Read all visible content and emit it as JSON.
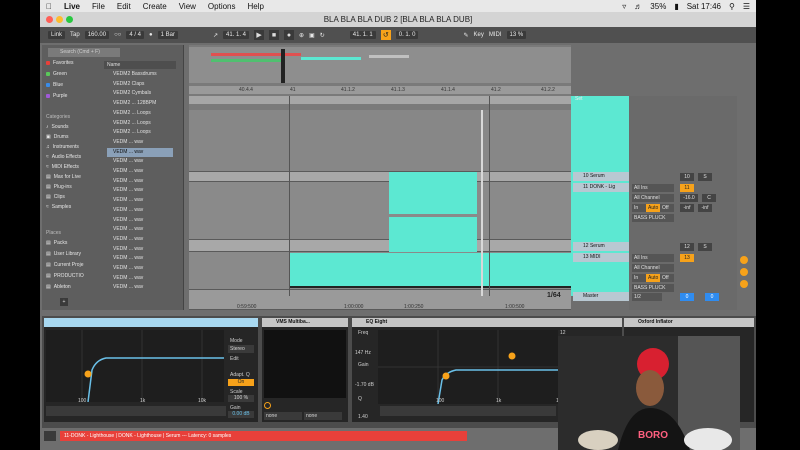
{
  "menubar": {
    "app": "Live",
    "items": [
      "File",
      "Edit",
      "Create",
      "View",
      "Options",
      "Help"
    ],
    "battery": "35%",
    "clock": "Sat 17:46"
  },
  "window": {
    "title": "BLA BLA BLA DUB 2  [BLA BLA BLA DUB]"
  },
  "transport": {
    "link": "Link",
    "tap": "Tap",
    "tempo": "160.00",
    "meter": "4 / 4",
    "quantize": "1 Bar",
    "position": "41.  1.  4",
    "loop_start": "41.  1.  1",
    "loop_length": "0.  1.  0",
    "key": "Key",
    "midi": "MIDI",
    "cpu": "13 %",
    "midi_track_num": "0"
  },
  "browser": {
    "search_placeholder": "Search (Cmd + F)",
    "collections": [
      {
        "label": "Favorites",
        "color": "#e8403a"
      },
      {
        "label": "Green",
        "color": "#5ac85a"
      },
      {
        "label": "Blue",
        "color": "#3a8ce8"
      },
      {
        "label": "Purple",
        "color": "#a05ad8"
      }
    ],
    "categories_title": "Categories",
    "categories": [
      "Sounds",
      "Drums",
      "Instruments",
      "Audio Effects",
      "MIDI Effects",
      "Max for Live",
      "Plug-ins",
      "Clips",
      "Samples"
    ],
    "places_title": "Places",
    "places": [
      "Packs",
      "User Library",
      "Current Proje",
      "PRODUCTIO",
      "Ableton"
    ],
    "file_header": "Name",
    "files": [
      "VEDM2 Bassdrums",
      "VEDM2 Claps",
      "VEDM2 Cymbals",
      "VEDM2 ... 128BPM",
      "VEDM2 ... Loops",
      "VEDM2 ... Loops",
      "VEDM2 ... Loops",
      "VEDM ... wav",
      "VEDM ... wav",
      "VEDM ... wav",
      "VEDM ... wav",
      "VEDM ... wav",
      "VEDM ... wav",
      "VEDM ... wav",
      "VEDM ... wav",
      "VEDM ... wav",
      "VEDM ... wav",
      "VEDM ... wav",
      "VEDM ... wav",
      "VEDM ... wav",
      "VEDM ... wav",
      "VEDM ... wav",
      "VEDM ... wav"
    ]
  },
  "arrangement": {
    "ruler_labels": [
      "40.4.4",
      "41",
      "41.1.2",
      "41.1.3",
      "41.1.4",
      "41.2",
      "41.2.2"
    ],
    "time_labels": [
      "0:59:500",
      "1:00:000",
      "1:00:250",
      "1:00:500"
    ],
    "zoom_label": "1/64"
  },
  "tracks": [
    {
      "name": "10 Serum",
      "num": "10",
      "arm": "S"
    },
    {
      "name": "11 DONK - Lig",
      "num": "11",
      "input": "All Ins",
      "channel": "All Channel",
      "monitor": [
        "In",
        "Auto",
        "Off"
      ],
      "pan": "C",
      "volume": "-16.0",
      "sends": [
        "-inf",
        "-inf"
      ],
      "instrument": "BASS PLUCK"
    },
    {
      "name": "12 Serum",
      "num": "12",
      "arm": "S"
    },
    {
      "name": "13 MIDI",
      "num": "13",
      "input": "All Ins",
      "channel": "All Channel",
      "monitor": [
        "In",
        "Auto",
        "Off"
      ],
      "instrument": "BASS PLUCK"
    },
    {
      "name": "Master",
      "num": "0",
      "cue": "1/2"
    }
  ],
  "devices": {
    "eq1": {
      "mode_label": "Mode",
      "mode": "Stereo",
      "edit_label": "Edit",
      "adapt_q_label": "Adapt. Q",
      "adapt_q": "On",
      "scale_label": "Scale",
      "scale": "100 %",
      "gain_label": "Gain",
      "gain": "0.00 dB",
      "freq_labels": [
        "100",
        "1k",
        "10k"
      ]
    },
    "vms": {
      "title": "VMS Multiba...",
      "none1": "none",
      "none2": "none"
    },
    "eq_eight": {
      "title": "EQ Eight",
      "freq_label": "Freq",
      "freq": "147 Hz",
      "gain_label": "Gain",
      "gain": "-1.70 dB",
      "q_label": "Q",
      "q": "1.40",
      "scale": [
        "12",
        "6",
        "0",
        "-6",
        "-12"
      ],
      "freq_labels": [
        "100",
        "1k",
        "10k"
      ]
    },
    "oxford": {
      "title": "Oxford Inflator"
    }
  },
  "status": "11-DONK - Lighthouse | DONK - Lighthouse | Serum  ---  Latency: 0 samples",
  "colors": {
    "clip": "#5ce8d2",
    "accent_orange": "#f7a21a",
    "status_red": "#e8403a"
  }
}
